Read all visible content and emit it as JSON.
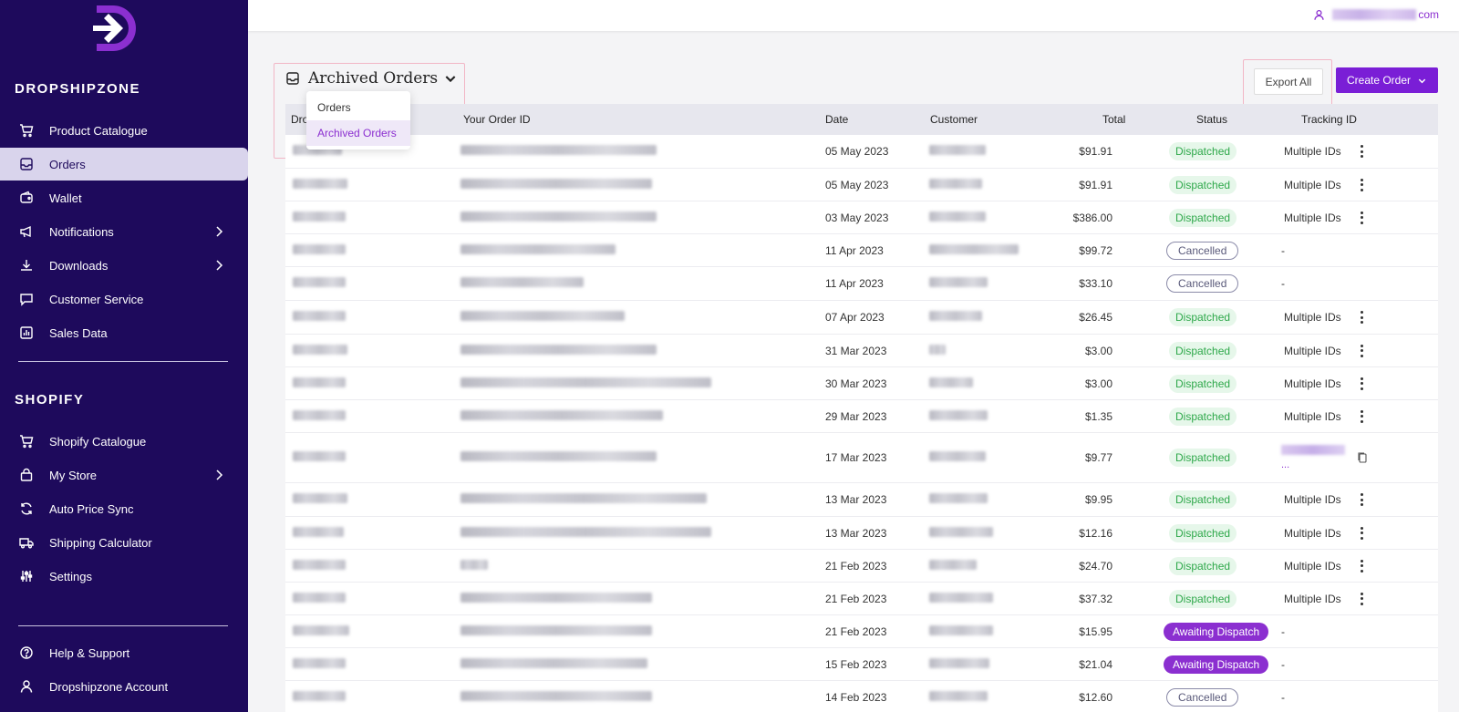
{
  "brand": {
    "accent": "#7a1ed6",
    "sidebar_bg": "#1e0a5c",
    "logo_icon": "arrow-right-icon"
  },
  "sidebar": {
    "section1_title": "DROPSHIPZONE",
    "section2_title": "SHOPIFY",
    "items": [
      {
        "label": "Product Catalogue",
        "icon": "cart-icon"
      },
      {
        "label": "Orders",
        "icon": "inbox-icon"
      },
      {
        "label": "Wallet",
        "icon": "wallet-icon"
      },
      {
        "label": "Notifications",
        "icon": "megaphone-icon"
      },
      {
        "label": "Downloads",
        "icon": "download-icon"
      },
      {
        "label": "Customer Service",
        "icon": "chat-icon"
      },
      {
        "label": "Sales Data",
        "icon": "bar-chart-icon"
      },
      {
        "label": "Shopify Catalogue",
        "icon": "cart-icon"
      },
      {
        "label": "My Store",
        "icon": "bag-icon"
      },
      {
        "label": "Auto Price Sync",
        "icon": "sync-icon"
      },
      {
        "label": "Shipping Calculator",
        "icon": "truck-icon"
      },
      {
        "label": "Settings",
        "icon": "sliders-icon"
      },
      {
        "label": "Help & Support",
        "icon": "help-icon"
      },
      {
        "label": "Dropshipzone Account",
        "icon": "user-icon"
      }
    ]
  },
  "topbar": {
    "user_suffix": "com",
    "user_icon": "user-icon"
  },
  "header": {
    "title": "Archived Orders",
    "dropdown": {
      "options": [
        "Orders",
        "Archived Orders"
      ],
      "selected": "Archived Orders"
    },
    "export_label": "Export All",
    "create_label": "Create Order"
  },
  "table": {
    "columns": [
      "Dro",
      "Your Order ID",
      "Date",
      "Customer",
      "Total",
      "Status",
      "Tracking ID"
    ],
    "rows": [
      {
        "date": "05 May 2023",
        "total": "$91.91",
        "status": "Dispatched",
        "tracking": "Multiple IDs"
      },
      {
        "date": "05 May 2023",
        "total": "$91.91",
        "status": "Dispatched",
        "tracking": "Multiple IDs"
      },
      {
        "date": "03 May 2023",
        "total": "$386.00",
        "status": "Dispatched",
        "tracking": "Multiple IDs"
      },
      {
        "date": "11 Apr 2023",
        "total": "$99.72",
        "status": "Cancelled",
        "tracking": "-"
      },
      {
        "date": "11 Apr 2023",
        "total": "$33.10",
        "status": "Cancelled",
        "tracking": "-"
      },
      {
        "date": "07 Apr 2023",
        "total": "$26.45",
        "status": "Dispatched",
        "tracking": "Multiple IDs"
      },
      {
        "date": "31 Mar 2023",
        "total": "$3.00",
        "status": "Dispatched",
        "tracking": "Multiple IDs"
      },
      {
        "date": "30 Mar 2023",
        "total": "$3.00",
        "status": "Dispatched",
        "tracking": "Multiple IDs"
      },
      {
        "date": "29 Mar 2023",
        "total": "$1.35",
        "status": "Dispatched",
        "tracking": "Multiple IDs"
      },
      {
        "date": "17 Mar 2023",
        "total": "$9.77",
        "status": "Dispatched",
        "tracking": "",
        "tracking_suffix": "..."
      },
      {
        "date": "13 Mar 2023",
        "total": "$9.95",
        "status": "Dispatched",
        "tracking": "Multiple IDs"
      },
      {
        "date": "13 Mar 2023",
        "total": "$12.16",
        "status": "Dispatched",
        "tracking": "Multiple IDs"
      },
      {
        "date": "21 Feb 2023",
        "total": "$24.70",
        "status": "Dispatched",
        "tracking": "Multiple IDs"
      },
      {
        "date": "21 Feb 2023",
        "total": "$37.32",
        "status": "Dispatched",
        "tracking": "Multiple IDs"
      },
      {
        "date": "21 Feb 2023",
        "total": "$15.95",
        "status": "Awaiting Dispatch",
        "tracking": "-"
      },
      {
        "date": "15 Feb 2023",
        "total": "$21.04",
        "status": "Awaiting Dispatch",
        "tracking": "-"
      },
      {
        "date": "14 Feb 2023",
        "total": "$12.60",
        "status": "Cancelled",
        "tracking": "-"
      }
    ]
  }
}
